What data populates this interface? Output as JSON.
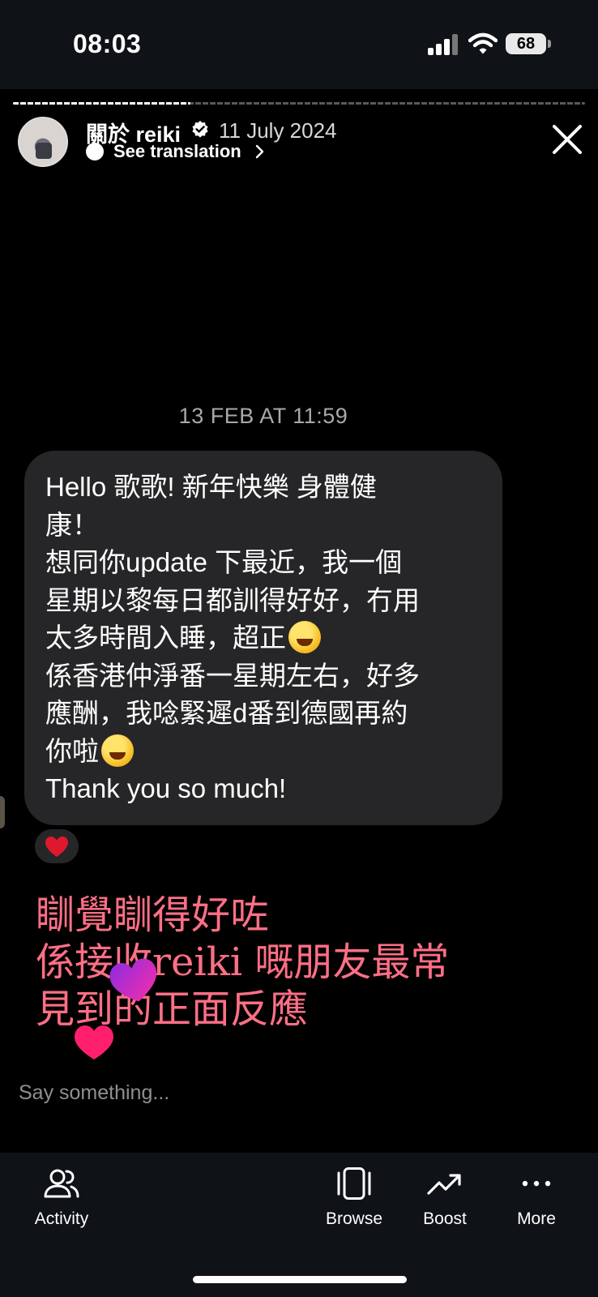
{
  "status_bar": {
    "time": "08:03",
    "battery": "68"
  },
  "story": {
    "progress": 0.31,
    "username": "關於 reiki",
    "verified": true,
    "date": "11 July 2024",
    "translation_link": "See translation",
    "message_timestamp": "13 FEB AT 11:59",
    "message_lines": [
      "Hello 歌歌! 新年快樂 身體健",
      "康！",
      "想同你update 下最近，我一個",
      "星期以黎每日都訓得好好，冇用",
      "太多時間入睡，超正",
      "係香港仲淨番一星期左右，好多",
      "應酬，我唸緊遲d番到德國再約",
      "你啦",
      "Thank you so much!"
    ],
    "overlay_lines": [
      "瞓覺瞓得好咗",
      "係接收reiki 嘅朋友最常",
      "見到的正面反應"
    ],
    "comment_placeholder": "Say something..."
  },
  "icons": {
    "close": "close-icon",
    "verified": "verified-badge-icon",
    "reaction": "heart-icon",
    "emoji_1": "grinning-squinting-face-emoji",
    "emoji_2": "winking-face-emoji"
  },
  "bottom_nav": {
    "activity": "Activity",
    "browse": "Browse",
    "boost": "Boost",
    "more": "More"
  },
  "colors": {
    "background": "#000000",
    "bubble": "#262628",
    "overlay_text": "#ff6f86",
    "reaction_heart": "#e0182d"
  }
}
